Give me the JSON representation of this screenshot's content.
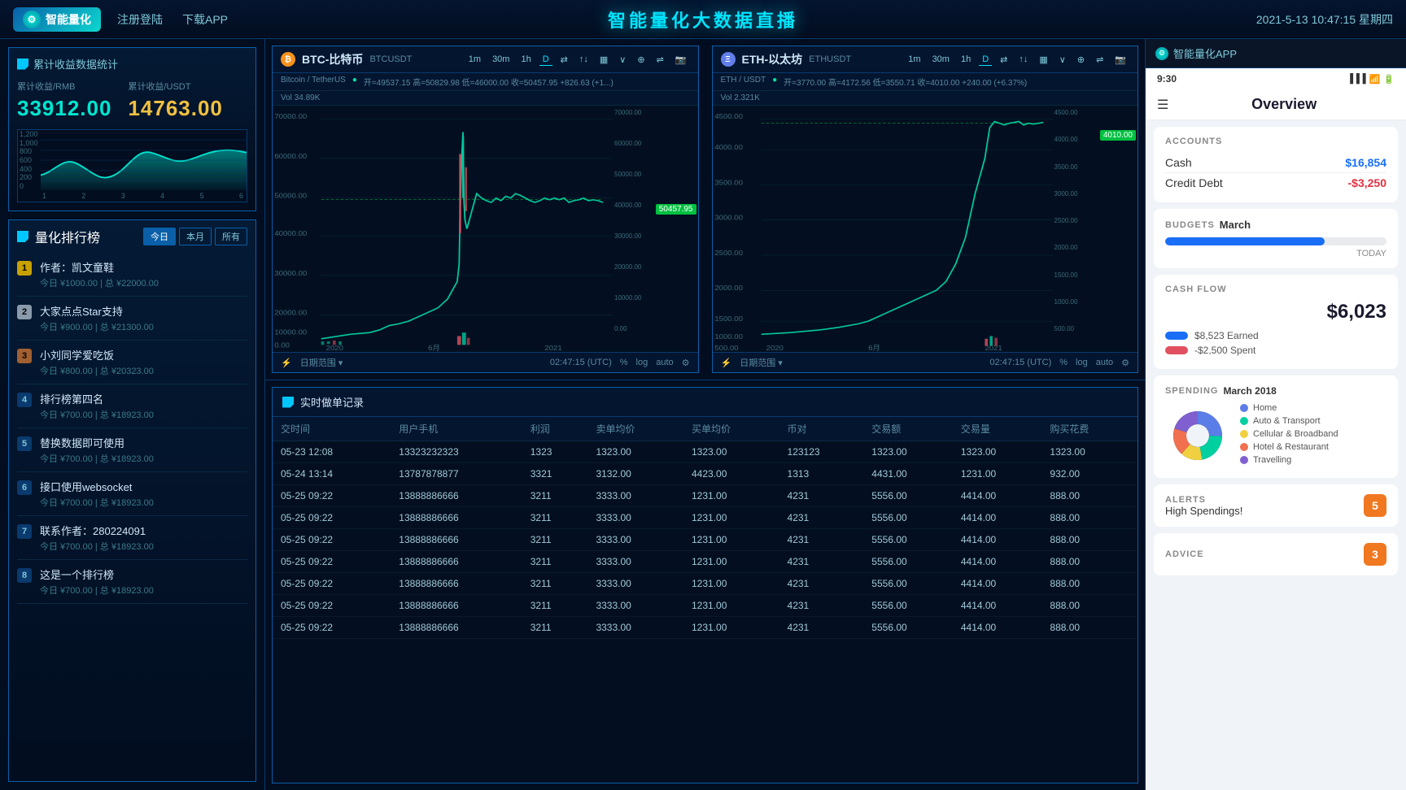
{
  "nav": {
    "logo_label": "智能量化",
    "link1": "注册登陆",
    "link2": "下载APP",
    "title": "智能量化大数据直播",
    "datetime": "2021-5-13  10:47:15  星期四"
  },
  "left": {
    "stats_section_title": "累计收益数据统计",
    "label_rmb": "累计收益/RMB",
    "label_usdt": "累计收益/USDT",
    "value_rmb": "33912.00",
    "value_usdt": "14763.00",
    "chart_y": [
      "1,200",
      "1,000",
      "800",
      "600",
      "400",
      "200",
      "0"
    ],
    "chart_x": [
      "1",
      "2",
      "3",
      "4",
      "5",
      "6"
    ],
    "ranking_title": "量化排行榜",
    "tab_today": "今日",
    "tab_month": "本月",
    "tab_all": "所有",
    "ranking_items": [
      {
        "rank": 1,
        "name": "作者：凯文童鞋",
        "sub": "今日 ¥1000.00 | 总 ¥22000.00"
      },
      {
        "rank": 2,
        "name": "大家点点Star支持",
        "sub": "今日 ¥900.00 | 总 ¥21300.00"
      },
      {
        "rank": 3,
        "name": "小刘同学爱吃饭",
        "sub": "今日 ¥800.00 | 总 ¥20323.00"
      },
      {
        "rank": 4,
        "name": "排行榜第四名",
        "sub": "今日 ¥700.00 | 总 ¥18923.00"
      },
      {
        "rank": 5,
        "name": "替换数据即可使用",
        "sub": "今日 ¥700.00 | 总 ¥18923.00"
      },
      {
        "rank": 6,
        "name": "接口使用websocket",
        "sub": "今日 ¥700.00 | 总 ¥18923.00"
      },
      {
        "rank": 7,
        "name": "联系作者：280224091",
        "sub": "今日 ¥700.00 | 总 ¥18923.00"
      },
      {
        "rank": 8,
        "name": "这是一个排行榜",
        "sub": "今日 ¥700.00 | 总 ¥18923.00"
      }
    ]
  },
  "btc": {
    "pair": "BTCUSDT",
    "intervals": [
      "1m",
      "30m",
      "1h",
      "D"
    ],
    "title": "BTC-比特币",
    "subtitle": "Bitcoin / TetherUS",
    "status": "●",
    "info": "开=49537.15  高=50829.98  低=46000.00  收=50457.95  +826.63  (+1...)",
    "vol": "Vol  34.89K",
    "price_label": "50457.95",
    "years": [
      "2020",
      "6月",
      "2021"
    ],
    "date_range": "日期范围 ▾",
    "time": "02:47:15 (UTC)",
    "log": "log",
    "auto": "auto"
  },
  "eth": {
    "pair": "ETHUSDT",
    "intervals": [
      "1m",
      "30m",
      "1h",
      "D"
    ],
    "title": "ETH-以太坊",
    "subtitle": "ETH / USDT",
    "status": "●",
    "info": "开=3770.00  高=4172.56  低=3550.71  收=4010.00  +240.00  (+6.37%)",
    "vol": "Vol  2.321K",
    "price_label": "4010.00",
    "years": [
      "2020",
      "6月",
      "2021"
    ],
    "date_range": "日期范围 ▾",
    "time": "02:47:15 (UTC)",
    "log": "log",
    "auto": "auto"
  },
  "trade": {
    "section_title": "实时做单记录",
    "columns": [
      "交时间",
      "用户手机",
      "利润",
      "卖单均价",
      "买单均价",
      "币对",
      "交易额",
      "交易量",
      "购买花费"
    ],
    "rows": [
      [
        "05-23  12:08",
        "13323232323",
        "1323",
        "1323.00",
        "1323.00",
        "123123",
        "1323.00",
        "1323.00",
        "1323.00"
      ],
      [
        "05-24  13:14",
        "13787878877",
        "3321",
        "3132.00",
        "4423.00",
        "1313",
        "4431.00",
        "1231.00",
        "932.00"
      ],
      [
        "05-25  09:22",
        "13888886666",
        "3211",
        "3333.00",
        "1231.00",
        "4231",
        "5556.00",
        "4414.00",
        "888.00"
      ],
      [
        "05-25  09:22",
        "13888886666",
        "3211",
        "3333.00",
        "1231.00",
        "4231",
        "5556.00",
        "4414.00",
        "888.00"
      ],
      [
        "05-25  09:22",
        "13888886666",
        "3211",
        "3333.00",
        "1231.00",
        "4231",
        "5556.00",
        "4414.00",
        "888.00"
      ],
      [
        "05-25  09:22",
        "13888886666",
        "3211",
        "3333.00",
        "1231.00",
        "4231",
        "5556.00",
        "4414.00",
        "888.00"
      ],
      [
        "05-25  09:22",
        "13888886666",
        "3211",
        "3333.00",
        "1231.00",
        "4231",
        "5556.00",
        "4414.00",
        "888.00"
      ],
      [
        "05-25  09:22",
        "13888886666",
        "3211",
        "3333.00",
        "1231.00",
        "4231",
        "5556.00",
        "4414.00",
        "888.00"
      ],
      [
        "05-25  09:22",
        "13888886666",
        "3211",
        "3333.00",
        "1231.00",
        "4231",
        "5556.00",
        "4414.00",
        "888.00"
      ]
    ]
  },
  "phone": {
    "app_title": "智能量化APP",
    "status_time": "9:30",
    "nav_title": "Overview",
    "accounts_title": "ACCOUNTS",
    "cash_label": "Cash",
    "cash_value": "$16,854",
    "credit_label": "Credit Debt",
    "credit_value": "-$3,250",
    "budgets_title": "BUDGETS",
    "budgets_month": "March",
    "budget_percent": 72,
    "budget_today": "TODAY",
    "cashflow_title": "CASH FLOW",
    "cashflow_total": "$6,023",
    "cashflow_earned": "$8,523 Earned",
    "cashflow_spent": "-$2,500 Spent",
    "spending_title": "SPENDING",
    "spending_month": "March 2018",
    "spending_categories": [
      {
        "label": "Home",
        "color": "#5b7de8"
      },
      {
        "label": "Auto & Transport",
        "color": "#00d0a0"
      },
      {
        "label": "Cellular & Broadband",
        "color": "#f0d040"
      },
      {
        "label": "Hotel & Restaurant",
        "color": "#f07050"
      },
      {
        "label": "Travelling",
        "color": "#8060d0"
      }
    ],
    "alerts_title": "ALERTS",
    "alerts_text": "High Spendings!",
    "alerts_count": "5",
    "advice_title": "ADVICE",
    "advice_count": "3"
  }
}
